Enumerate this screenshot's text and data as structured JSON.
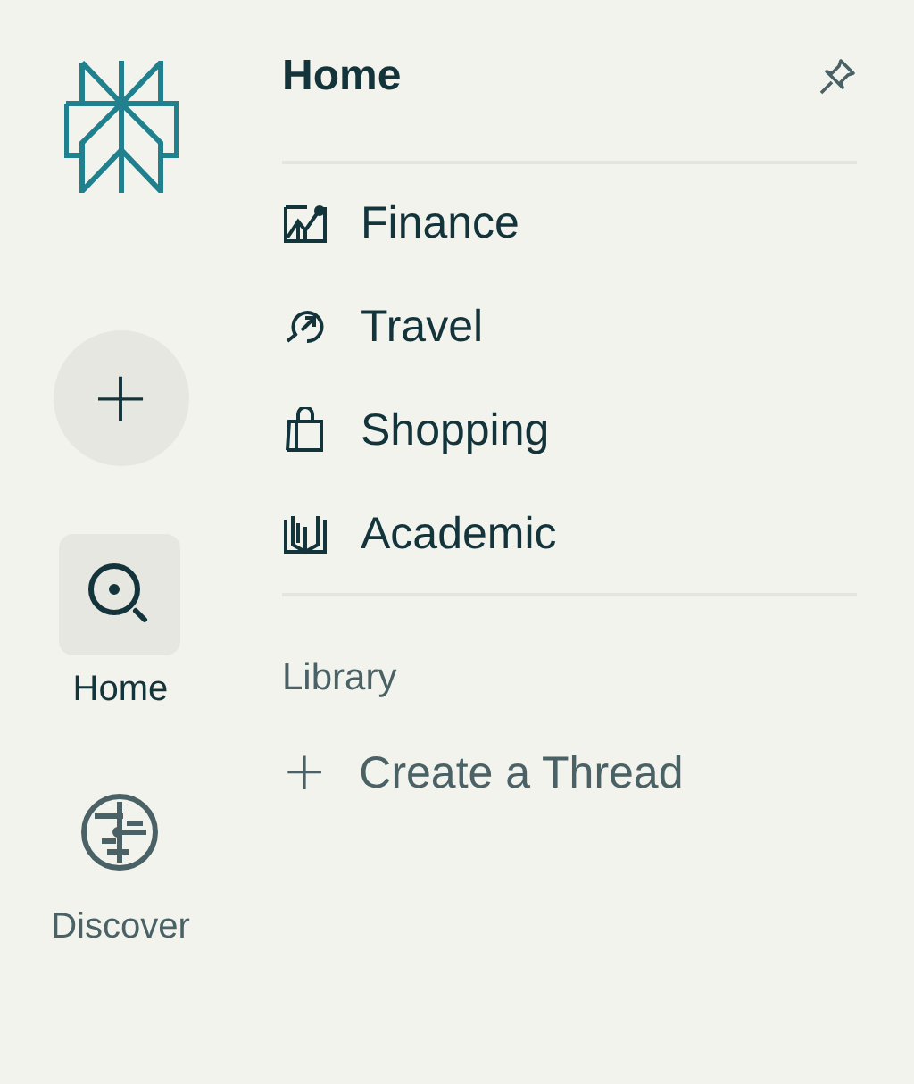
{
  "nav": [
    {
      "label": "Home",
      "kind": "search",
      "selected": true
    },
    {
      "label": "Discover",
      "kind": "globe",
      "selected": false
    }
  ],
  "panel": {
    "title": "Home",
    "topics": [
      {
        "label": "Finance",
        "kind": "chart"
      },
      {
        "label": "Travel",
        "kind": "plane"
      },
      {
        "label": "Shopping",
        "kind": "bag"
      },
      {
        "label": "Academic",
        "kind": "book"
      }
    ],
    "section": "Library",
    "action": {
      "icon": "+",
      "label": "Create a Thread"
    }
  },
  "new_button": "+"
}
